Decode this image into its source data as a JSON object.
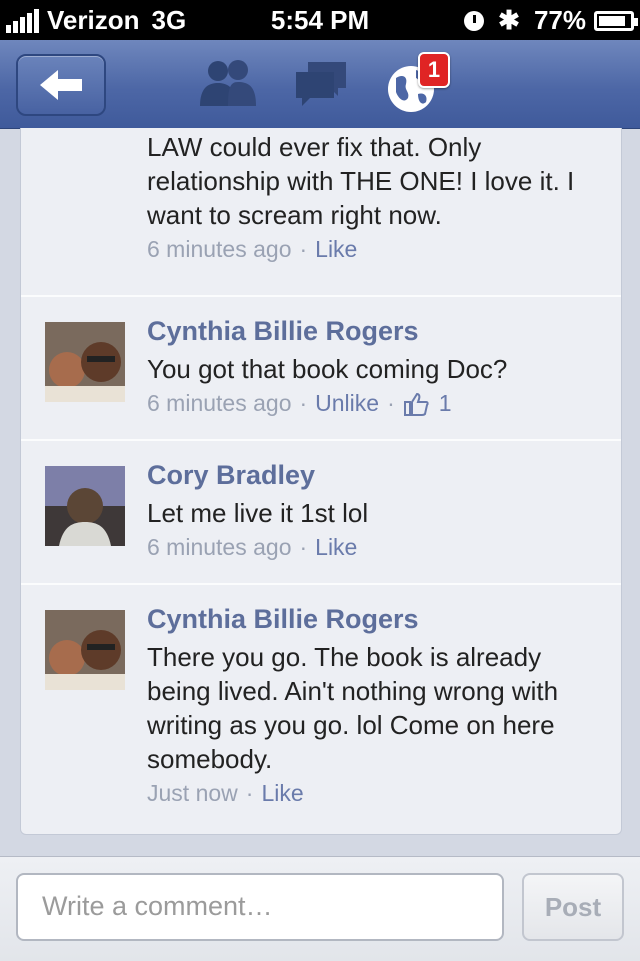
{
  "status_bar": {
    "carrier": "Verizon",
    "network": "3G",
    "time": "5:54 PM",
    "battery": "77%"
  },
  "nav": {
    "notification_count": "1"
  },
  "comments": [
    {
      "author": "",
      "text": "No church laws, no family laws, NO LAW could ever fix that. Only relationship with THE ONE! I love it. I want to scream right now.",
      "time": "6 minutes ago",
      "action": "Like"
    },
    {
      "author": "Cynthia Billie Rogers",
      "text": "You got that book coming Doc?",
      "time": "6 minutes ago",
      "action": "Unlike",
      "likes": "1"
    },
    {
      "author": "Cory Bradley",
      "text": "Let me live it 1st lol",
      "time": "6 minutes ago",
      "action": "Like"
    },
    {
      "author": "Cynthia Billie Rogers",
      "text": "There you go. The book is already being lived. Ain't nothing wrong with writing as you go. lol  Come on here somebody.",
      "time": "Just now",
      "action": "Like"
    }
  ],
  "compose": {
    "placeholder": "Write a comment…",
    "post_label": "Post"
  }
}
